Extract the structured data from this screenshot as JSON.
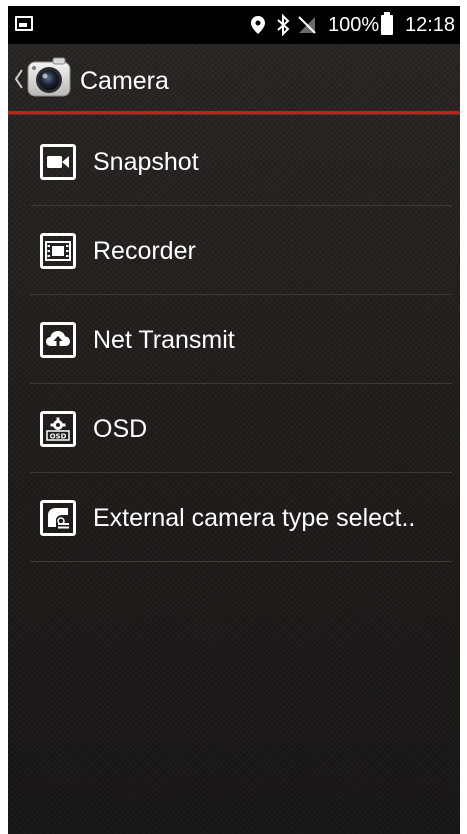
{
  "status_bar": {
    "battery_percent": "100%",
    "time": "12:18",
    "icons": [
      "notification-image-icon",
      "location-icon",
      "bluetooth-icon",
      "no-sim-icon",
      "battery-icon"
    ]
  },
  "action_bar": {
    "title": "Camera",
    "app_icon": "camera-app-icon",
    "back_icon": "back-chevron-icon",
    "accent_color": "#b5261b"
  },
  "menu": {
    "items": [
      {
        "label": "Snapshot",
        "icon": "video-camera-icon"
      },
      {
        "label": "Recorder",
        "icon": "film-icon"
      },
      {
        "label": "Net Transmit",
        "icon": "cloud-upload-icon"
      },
      {
        "label": "OSD",
        "icon": "osd-icon"
      },
      {
        "label": "External camera type select..",
        "icon": "external-camera-icon"
      }
    ]
  }
}
